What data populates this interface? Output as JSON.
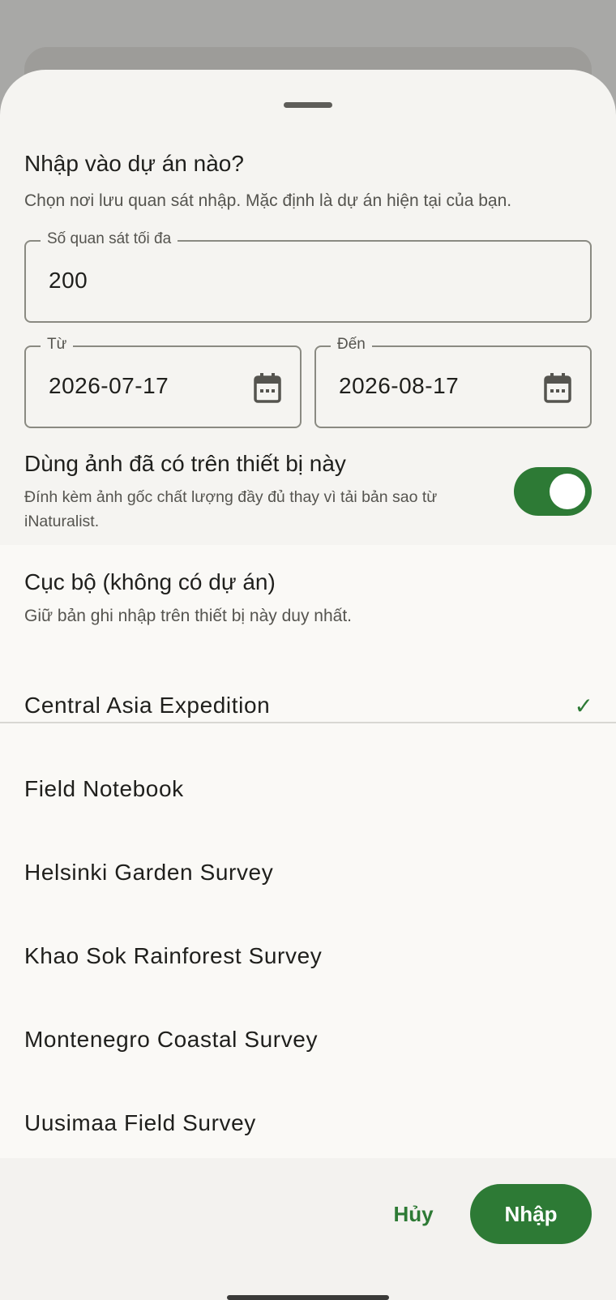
{
  "sheet": {
    "title": "Nhập vào dự án nào?",
    "subtitle": "Chọn nơi lưu quan sát nhập. Mặc định là dự án hiện tại của bạn."
  },
  "fields": {
    "max_label": "Số quan sát tối đa",
    "max_value": "200",
    "from_label": "Từ",
    "from_value": "2026-07-17",
    "to_label": "Đến",
    "to_value": "2026-08-17"
  },
  "toggle": {
    "title": "Dùng ảnh đã có trên thiết bị này",
    "description": "Đính kèm ảnh gốc chất lượng đầy đủ thay vì tải bản sao từ iNaturalist.",
    "on": true
  },
  "local": {
    "title": "Cục bộ (không có dự án)",
    "description": "Giữ bản ghi nhập trên thiết bị này duy nhất."
  },
  "projects": [
    {
      "name": "Central Asia Expedition",
      "selected_mark": "✓"
    },
    {
      "name": "Field Notebook",
      "selected_mark": ""
    },
    {
      "name": "Helsinki Garden Survey",
      "selected_mark": ""
    },
    {
      "name": "Khao Sok Rainforest Survey",
      "selected_mark": ""
    },
    {
      "name": "Montenegro Coastal Survey",
      "selected_mark": ""
    },
    {
      "name": "Uusimaa Field Survey",
      "selected_mark": ""
    }
  ],
  "footer": {
    "cancel_label": "Hủy",
    "import_label": "Nhập"
  },
  "colors": {
    "accent": "#2d7a35",
    "scrim": "#a8a8a6",
    "sheet": "#f5f4f1"
  }
}
